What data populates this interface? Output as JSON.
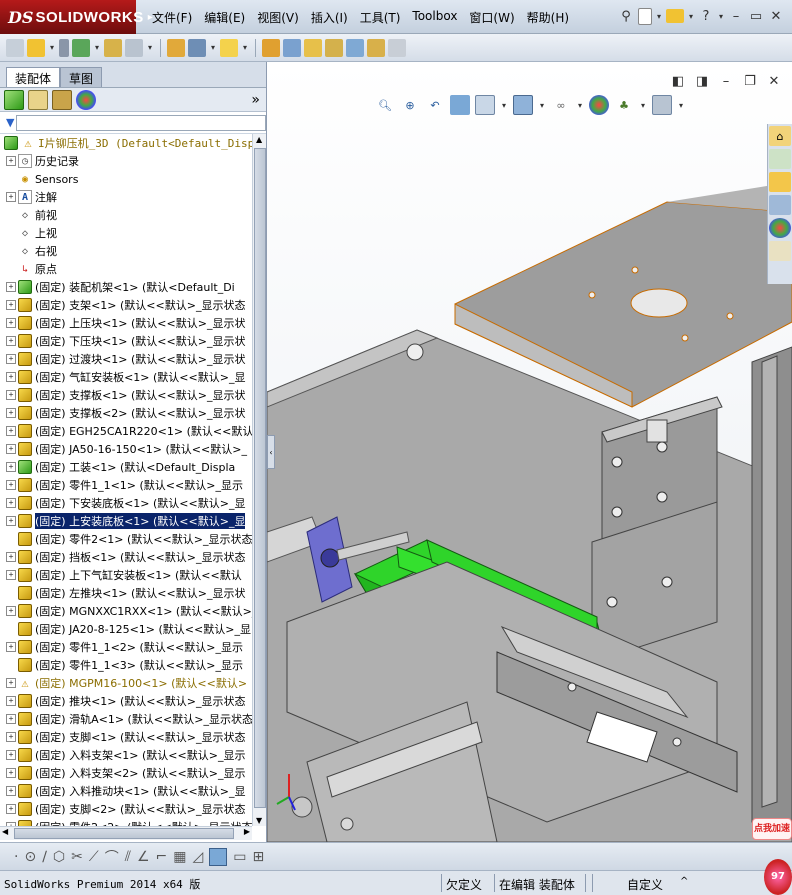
{
  "app": {
    "logo_prefix": "DS",
    "logo_name": "SOLIDWORKS"
  },
  "menu": [
    "文件(F)",
    "编辑(E)",
    "视图(V)",
    "插入(I)",
    "工具(T)",
    "Toolbox",
    "窗口(W)",
    "帮助(H)"
  ],
  "tabs": {
    "assembly": "装配体",
    "sketch": "草图"
  },
  "tree": {
    "root": "I片铆压机_3D  (Default<Default_Disp",
    "items": [
      {
        "label": "历史记录",
        "icon": "history-icon",
        "exp": true
      },
      {
        "label": "Sensors",
        "icon": "sensor-icon",
        "exp": false
      },
      {
        "label": "注解",
        "icon": "annotation-icon",
        "exp": true
      },
      {
        "label": "前视",
        "icon": "plane-icon",
        "exp": false
      },
      {
        "label": "上视",
        "icon": "plane-icon",
        "exp": false
      },
      {
        "label": "右视",
        "icon": "plane-icon",
        "exp": false
      },
      {
        "label": "原点",
        "icon": "origin-icon",
        "exp": false
      },
      {
        "label": "(固定) 装配机架<1> (默认<Default_Di",
        "icon": "assembly-icon",
        "exp": true
      },
      {
        "label": "(固定) 支架<1> (默认<<默认>_显示状态",
        "icon": "part-icon",
        "exp": true
      },
      {
        "label": "(固定) 上压块<1> (默认<<默认>_显示状",
        "icon": "part-icon",
        "exp": true
      },
      {
        "label": "(固定) 下压块<1> (默认<<默认>_显示状",
        "icon": "part-icon",
        "exp": true
      },
      {
        "label": "(固定) 过渡块<1> (默认<<默认>_显示状",
        "icon": "part-icon",
        "exp": true
      },
      {
        "label": "(固定) 气缸安装板<1> (默认<<默认>_显",
        "icon": "part-icon",
        "exp": true
      },
      {
        "label": "(固定) 支撑板<1> (默认<<默认>_显示状",
        "icon": "part-icon",
        "exp": true
      },
      {
        "label": "(固定) 支撑板<2> (默认<<默认>_显示状",
        "icon": "part-icon",
        "exp": true
      },
      {
        "label": "(固定) EGH25CA1R220<1> (默认<<默认>",
        "icon": "part-icon",
        "exp": true
      },
      {
        "label": "(固定) JA50-16-150<1> (默认<<默认>_",
        "icon": "part-icon",
        "exp": true
      },
      {
        "label": "(固定) 工装<1> (默认<Default_Displa",
        "icon": "assembly-icon",
        "exp": true
      },
      {
        "label": "(固定) 零件1_1<1> (默认<<默认>_显示",
        "icon": "part-icon",
        "exp": true
      },
      {
        "label": "(固定) 下安装底板<1> (默认<<默认>_显",
        "icon": "part-icon",
        "exp": true
      },
      {
        "label": "(固定) 上安装底板<1> (默认<<默认>_显",
        "icon": "part-icon",
        "exp": true,
        "selected": true
      },
      {
        "label": "(固定) 零件2<1> (默认<<默认>_显示状态",
        "icon": "part-icon",
        "exp": false
      },
      {
        "label": "(固定) 挡板<1> (默认<<默认>_显示状态",
        "icon": "part-icon",
        "exp": true
      },
      {
        "label": "(固定) 上下气缸安装板<1> (默认<<默认",
        "icon": "part-icon",
        "exp": true
      },
      {
        "label": "(固定) 左推块<1> (默认<<默认>_显示状",
        "icon": "part-icon",
        "exp": false
      },
      {
        "label": "(固定) MGNXXC1RXX<1> (默认<<默认>_显",
        "icon": "part-icon",
        "exp": true
      },
      {
        "label": "(固定) JA20-8-125<1> (默认<<默认>_显",
        "icon": "part-icon",
        "exp": false
      },
      {
        "label": "(固定) 零件1_1<2> (默认<<默认>_显示",
        "icon": "part-icon",
        "exp": true
      },
      {
        "label": "(固定) 零件1_1<3> (默认<<默认>_显示",
        "icon": "part-icon",
        "exp": false
      },
      {
        "label": "(固定) MGPM16-100<1> (默认<<默认>",
        "icon": "warning-icon",
        "exp": true,
        "warn": true
      },
      {
        "label": "(固定) 推块<1> (默认<<默认>_显示状态",
        "icon": "part-icon",
        "exp": true
      },
      {
        "label": "(固定) 滑轨A<1> (默认<<默认>_显示状态",
        "icon": "part-icon",
        "exp": true
      },
      {
        "label": "(固定) 支脚<1> (默认<<默认>_显示状态",
        "icon": "part-icon",
        "exp": true
      },
      {
        "label": "(固定) 入料支架<1> (默认<<默认>_显示",
        "icon": "part-icon",
        "exp": true
      },
      {
        "label": "(固定) 入料支架<2> (默认<<默认>_显示",
        "icon": "part-icon",
        "exp": true
      },
      {
        "label": "(固定) 入料推动块<1> (默认<<默认>_显",
        "icon": "part-icon",
        "exp": true
      },
      {
        "label": "(固定) 支脚<2> (默认<<默认>_显示状态",
        "icon": "part-icon",
        "exp": true
      },
      {
        "label": "(固定) 零件2<2> (默认<<默认>_显示状态",
        "icon": "part-icon",
        "exp": true
      }
    ]
  },
  "status": {
    "version": "SolidWorks Premium 2014 x64 版",
    "underdefined": "欠定义",
    "editing": "在编辑 装配体",
    "custom": "自定义",
    "caret": "^"
  },
  "watermark": {
    "text": "点我加速",
    "badge": "97"
  },
  "colors": {
    "logo_red": "#b51a1a",
    "selection": "#0a246a",
    "green_part": "#2fd42a",
    "part_grey": "#b8b8b8"
  }
}
